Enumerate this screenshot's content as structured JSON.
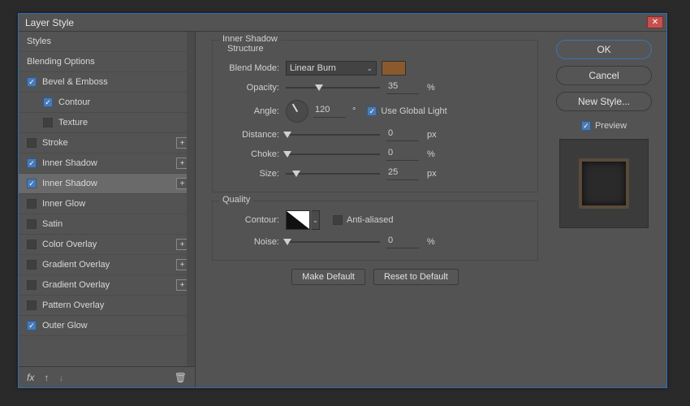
{
  "dialog": {
    "title": "Layer Style"
  },
  "sidebar": {
    "header": "Styles",
    "blending": "Blending Options",
    "items": [
      {
        "label": "Bevel & Emboss",
        "checked": true,
        "plus": false,
        "indent": 0
      },
      {
        "label": "Contour",
        "checked": true,
        "plus": false,
        "indent": 1
      },
      {
        "label": "Texture",
        "checked": false,
        "plus": false,
        "indent": 1
      },
      {
        "label": "Stroke",
        "checked": false,
        "plus": true,
        "indent": 0
      },
      {
        "label": "Inner Shadow",
        "checked": true,
        "plus": true,
        "indent": 0
      },
      {
        "label": "Inner Shadow",
        "checked": true,
        "plus": true,
        "indent": 0,
        "selected": true
      },
      {
        "label": "Inner Glow",
        "checked": false,
        "plus": false,
        "indent": 0
      },
      {
        "label": "Satin",
        "checked": false,
        "plus": false,
        "indent": 0
      },
      {
        "label": "Color Overlay",
        "checked": false,
        "plus": true,
        "indent": 0
      },
      {
        "label": "Gradient Overlay",
        "checked": false,
        "plus": true,
        "indent": 0
      },
      {
        "label": "Gradient Overlay",
        "checked": false,
        "plus": true,
        "indent": 0
      },
      {
        "label": "Pattern Overlay",
        "checked": false,
        "plus": false,
        "indent": 0
      },
      {
        "label": "Outer Glow",
        "checked": true,
        "plus": false,
        "indent": 0
      }
    ],
    "fx_label": "fx"
  },
  "panel": {
    "title": "Inner Shadow",
    "structure_title": "Structure",
    "blend_mode_label": "Blend Mode:",
    "blend_mode_value": "Linear Burn",
    "swatch_color": "#8a5a2e",
    "opacity_label": "Opacity:",
    "opacity_value": "35",
    "opacity_unit": "%",
    "angle_label": "Angle:",
    "angle_value": "120",
    "angle_unit": "°",
    "global_light_label": "Use Global Light",
    "global_light_checked": true,
    "distance_label": "Distance:",
    "distance_value": "0",
    "distance_unit": "px",
    "choke_label": "Choke:",
    "choke_value": "0",
    "choke_unit": "%",
    "size_label": "Size:",
    "size_value": "25",
    "size_unit": "px",
    "quality_title": "Quality",
    "contour_label": "Contour:",
    "antialiased_label": "Anti-aliased",
    "antialiased_checked": false,
    "noise_label": "Noise:",
    "noise_value": "0",
    "noise_unit": "%",
    "make_default": "Make Default",
    "reset_default": "Reset to Default"
  },
  "buttons": {
    "ok": "OK",
    "cancel": "Cancel",
    "new_style": "New Style...",
    "preview": "Preview",
    "preview_checked": true
  }
}
